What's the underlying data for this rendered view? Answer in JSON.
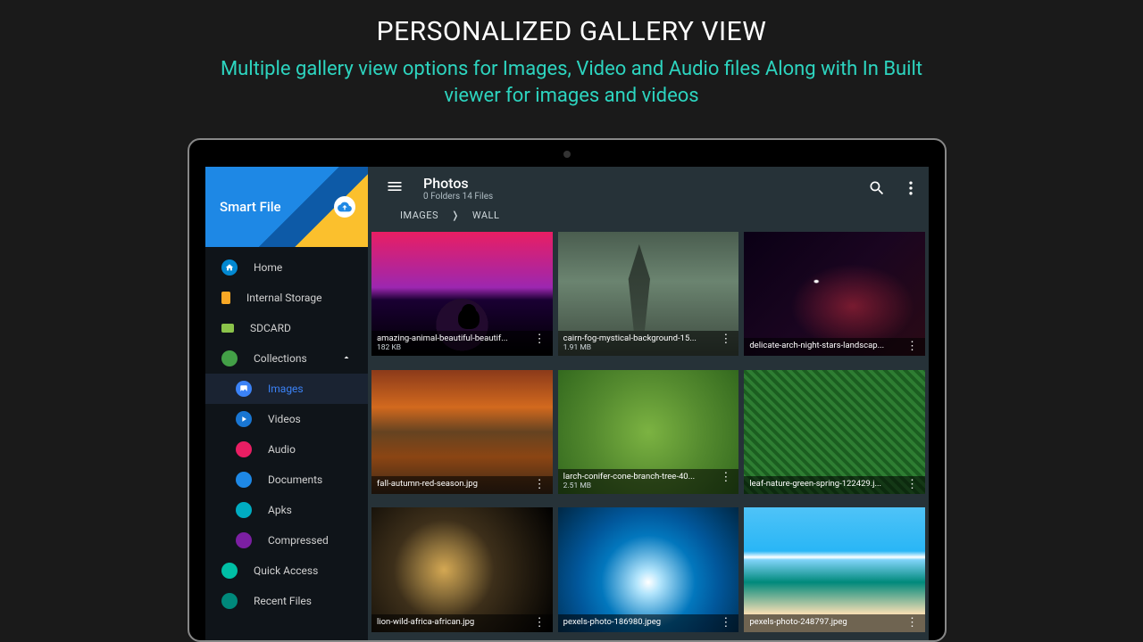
{
  "promo": {
    "title": "PERSONALIZED GALLERY VIEW",
    "subtitle": "Multiple gallery view options for Images, Video and Audio files Along with In Built viewer for images and videos"
  },
  "brand": {
    "name": "Smart File"
  },
  "header": {
    "title": "Photos",
    "subtitle": "0 Folders 14 Files"
  },
  "breadcrumbs": {
    "a": "IMAGES",
    "b": "WALL",
    "sep": "❭"
  },
  "nav": {
    "home": "Home",
    "internal": "Internal Storage",
    "sdcard": "SDCARD",
    "collections": "Collections",
    "images": "Images",
    "videos": "Videos",
    "audio": "Audio",
    "documents": "Documents",
    "apks": "Apks",
    "compressed": "Compressed",
    "quick": "Quick Access",
    "recent": "Recent Files"
  },
  "tiles": [
    {
      "name": "amazing-animal-beautiful-beautif...",
      "size": "182 KB"
    },
    {
      "name": "cairn-fog-mystical-background-15...",
      "size": "1.91 MB"
    },
    {
      "name": "delicate-arch-night-stars-landscap...",
      "size": ""
    },
    {
      "name": "fall-autumn-red-season.jpg",
      "size": ""
    },
    {
      "name": "larch-conifer-cone-branch-tree-40...",
      "size": "2.51 MB"
    },
    {
      "name": "leaf-nature-green-spring-122429.j...",
      "size": ""
    },
    {
      "name": "lion-wild-africa-african.jpg",
      "size": ""
    },
    {
      "name": "pexels-photo-186980.jpeg",
      "size": ""
    },
    {
      "name": "pexels-photo-248797.jpeg",
      "size": ""
    }
  ]
}
